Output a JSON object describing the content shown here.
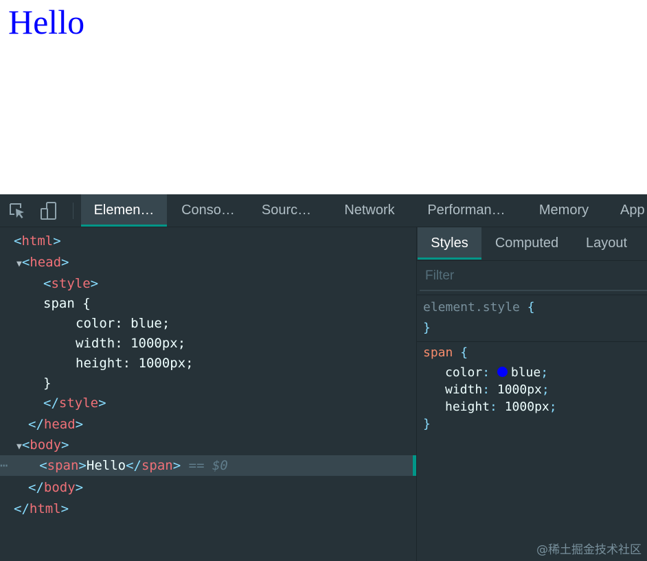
{
  "viewport": {
    "text": "Hello"
  },
  "toolbar": {
    "inspect_icon": "inspect-element-icon",
    "device_icon": "device-toolbar-icon",
    "tabs": [
      {
        "label": "Elemen…",
        "active": true
      },
      {
        "label": "Conso…"
      },
      {
        "label": "Sourc…"
      },
      {
        "label": "Network"
      },
      {
        "label": "Performan…"
      },
      {
        "label": "Memory"
      },
      {
        "label": "App"
      }
    ]
  },
  "elements": {
    "selected_suffix": "== $0",
    "lines": [
      {
        "open": "<",
        "tag": "html",
        "close": ">"
      },
      {
        "open": "<",
        "tag": "head",
        "close": ">"
      },
      {
        "open": "<",
        "tag": "style",
        "close": ">"
      },
      {
        "text": "span {"
      },
      {
        "text": "color: blue;"
      },
      {
        "text": "width: 1000px;"
      },
      {
        "text": "height: 1000px;"
      },
      {
        "text": "}"
      },
      {
        "open": "</",
        "tag": "style",
        "close": ">"
      },
      {
        "open": "</",
        "tag": "head",
        "close": ">"
      },
      {
        "open": "<",
        "tag": "body",
        "close": ">"
      },
      {
        "open": "<",
        "tag": "span",
        "close": ">",
        "content": "Hello",
        "open2": "</",
        "tag2": "span",
        "close2": ">"
      },
      {
        "open": "</",
        "tag": "body",
        "close": ">"
      },
      {
        "open": "</",
        "tag": "html",
        "close": ">"
      }
    ]
  },
  "sidebar": {
    "tabs": [
      {
        "label": "Styles",
        "active": true
      },
      {
        "label": "Computed"
      },
      {
        "label": "Layout"
      }
    ],
    "filter_placeholder": "Filter",
    "element_style": {
      "selector": "element.style",
      "open": "{",
      "close": "}"
    },
    "span_rule": {
      "selector": "span",
      "open": "{",
      "close": "}",
      "declarations": [
        {
          "prop": "color",
          "value": "blue",
          "swatch": "#0000ff"
        },
        {
          "prop": "width",
          "value": "1000px"
        },
        {
          "prop": "height",
          "value": "1000px"
        }
      ]
    }
  },
  "watermark": "@稀土掘金技术社区"
}
